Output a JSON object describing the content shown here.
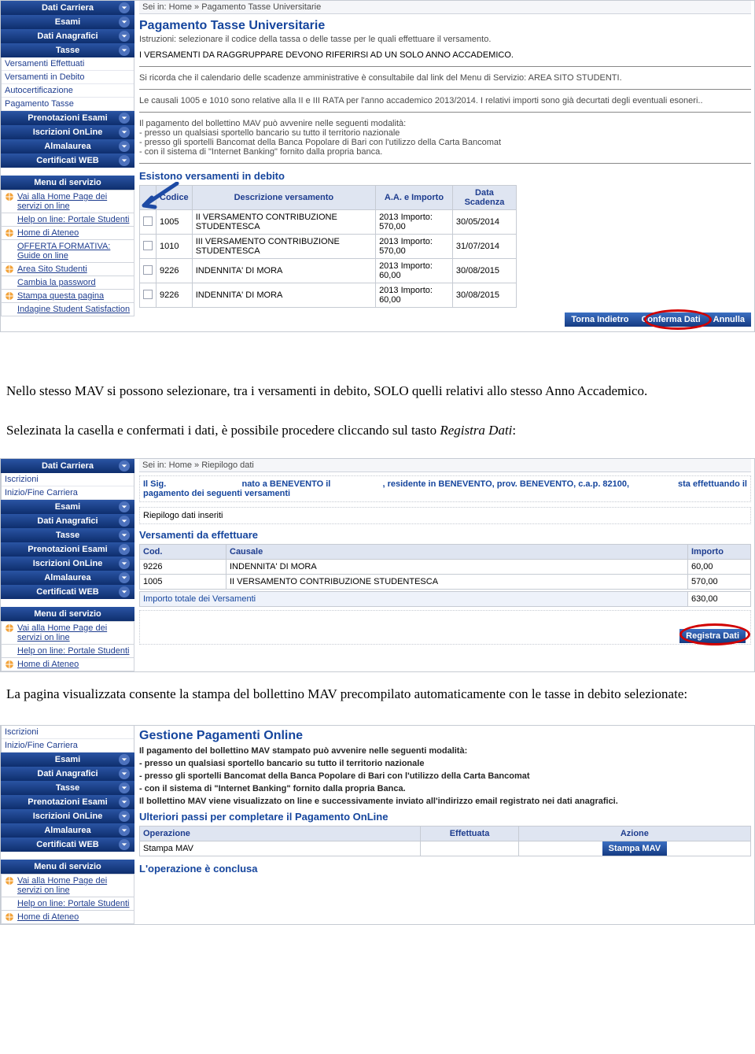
{
  "screenshot1": {
    "breadcrumb": "Sei in: Home » Pagamento Tasse Universitarie",
    "sidebar": {
      "groups": [
        {
          "label": "Dati Carriera",
          "sub": []
        },
        {
          "label": "Esami",
          "sub": []
        },
        {
          "label": "Dati Anagrafici",
          "sub": []
        },
        {
          "label": "Tasse",
          "open": true,
          "sub": [
            "Versamenti Effettuati",
            "Versamenti in Debito",
            "Autocertificazione",
            "Pagamento Tasse"
          ]
        },
        {
          "label": "Prenotazioni Esami"
        },
        {
          "label": "Iscrizioni OnLine"
        },
        {
          "label": "Almalaurea"
        },
        {
          "label": "Certificati WEB"
        }
      ],
      "service_title": "Menu di servizio",
      "service": [
        "Vai alla Home Page dei servizi on line",
        "Help on line: Portale Studenti",
        "Home di Ateneo",
        "OFFERTA FORMATIVA: Guide on line",
        "Area Sito Studenti",
        "Cambia la password",
        "Stampa questa pagina",
        "Indagine Student Satisfaction"
      ]
    },
    "title": "Pagamento Tasse Universitarie",
    "instr": "Istruzioni: selezionare il codice della tassa o delle tasse per le quali effettuare il versamento.",
    "line1": "I VERSAMENTI DA RAGGRUPPARE DEVONO RIFERIRSI AD UN SOLO ANNO ACCADEMICO.",
    "line2": "Si ricorda che il calendario delle scadenze amministrative è consultabile dal link del Menu di Servizio: AREA SITO STUDENTI.",
    "line3": "Le causali 1005 e 1010 sono relative alla II e III RATA per l'anno accademico 2013/2014. I relativi importi sono già decurtati degli eventuali esoneri..",
    "block4": [
      "Il pagamento del bollettino MAV può avvenire nelle seguenti modalità:",
      "- presso un qualsiasi sportello bancario su tutto il territorio nazionale",
      "- presso gli sportelli Bancomat della Banca Popolare di Bari con l'utilizzo della Carta Bancomat",
      "- con il sistema di \"Internet Banking\" fornito dalla propria banca."
    ],
    "tbl_title": "Esistono versamenti in debito",
    "tbl_headers": [
      "Codice",
      "Descrizione versamento",
      "A.A. e Importo",
      "Data Scadenza"
    ],
    "rows": [
      {
        "code": "1005",
        "desc": "II VERSAMENTO CONTRIBUZIONE STUDENTESCA",
        "aa": "2013 Importo: 570,00",
        "date": "30/05/2014"
      },
      {
        "code": "1010",
        "desc": "III VERSAMENTO CONTRIBUZIONE STUDENTESCA",
        "aa": "2013 Importo: 570,00",
        "date": "31/07/2014"
      },
      {
        "code": "9226",
        "desc": "INDENNITA' DI MORA",
        "aa": "2013 Importo: 60,00",
        "date": "30/08/2015"
      },
      {
        "code": "9226",
        "desc": "INDENNITA' DI MORA",
        "aa": "2013 Importo: 60,00",
        "date": "30/08/2015"
      }
    ],
    "buttons": {
      "back": "Torna Indietro",
      "confirm": "Conferma Dati",
      "cancel": "Annulla"
    }
  },
  "body_text": {
    "p1": "Nello stesso MAV si possono selezionare, tra i versamenti in debito, SOLO quelli relativi allo stesso Anno Accademico.",
    "p2a": "Selezinata la casella e confermati i dati, è possibile procedere cliccando sul tasto ",
    "p2b": "Registra Dati",
    "p2c": ":",
    "p3": "La pagina visualizzata consente la stampa del bollettino MAV precompilato automaticamente con le tasse in debito selezionate:"
  },
  "screenshot2": {
    "breadcrumb": "Sei in: Home » Riepilogo dati",
    "sidebar": {
      "groups": [
        {
          "label": "Dati Carriera",
          "open": true,
          "sub": [
            "Iscrizioni",
            "Inizio/Fine Carriera"
          ]
        },
        {
          "label": "Esami"
        },
        {
          "label": "Dati Anagrafici"
        },
        {
          "label": "Tasse"
        },
        {
          "label": "Prenotazioni Esami"
        },
        {
          "label": "Iscrizioni OnLine"
        },
        {
          "label": "Almalaurea"
        },
        {
          "label": "Certificati WEB"
        }
      ],
      "service_title": "Menu di servizio",
      "service": [
        "Vai alla Home Page dei servizi on line",
        "Help on line: Portale Studenti",
        "Home di Ateneo"
      ]
    },
    "topbox": {
      "a": "Il Sig.",
      "b": "nato a BENEVENTO il",
      "c": ", residente in BENEVENTO, prov. BENEVENTO, c.a.p. 82100,",
      "d": "sta effettuando il",
      "e": "pagamento dei seguenti versamenti"
    },
    "riep": "Riepilogo dati inseriti",
    "vtitle": "Versamenti da effettuare",
    "vheaders": [
      "Cod.",
      "Causale",
      "Importo"
    ],
    "vrows": [
      {
        "c": "9226",
        "d": "INDENNITA' DI MORA",
        "i": "60,00"
      },
      {
        "c": "1005",
        "d": "II VERSAMENTO CONTRIBUZIONE STUDENTESCA",
        "i": "570,00"
      }
    ],
    "tot_label": "Importo totale dei Versamenti",
    "tot_val": "630,00",
    "btn": "Registra Dati"
  },
  "screenshot3": {
    "sidebar": {
      "pre_sub": [
        "Iscrizioni",
        "Inizio/Fine Carriera"
      ],
      "groups": [
        {
          "label": "Esami"
        },
        {
          "label": "Dati Anagrafici"
        },
        {
          "label": "Tasse"
        },
        {
          "label": "Prenotazioni Esami"
        },
        {
          "label": "Iscrizioni OnLine"
        },
        {
          "label": "Almalaurea"
        },
        {
          "label": "Certificati WEB"
        }
      ],
      "service_title": "Menu di servizio",
      "service": [
        "Vai alla Home Page dei servizi on line",
        "Help on line: Portale Studenti",
        "Home di Ateneo"
      ]
    },
    "title": "Gestione Pagamenti Online",
    "lines": [
      "Il pagamento del bollettino MAV stampato può avvenire nelle seguenti modalità:",
      "- presso un qualsiasi sportello bancario su tutto il territorio nazionale",
      "- presso gli sportelli Bancomat della Banca Popolare di Bari con l'utilizzo della Carta Bancomat",
      "- con il sistema di \"Internet Banking\" fornito dalla propria Banca.",
      "Il bollettino MAV viene visualizzato on line e successivamente inviato all'indirizzo email registrato nei dati anagrafici."
    ],
    "sub": "Ulteriori passi per completare il Pagamento OnLine",
    "op_headers": [
      "Operazione",
      "Effettuata",
      "Azione"
    ],
    "op_row": {
      "op": "Stampa MAV",
      "eff": "",
      "btn": "Stampa MAV"
    },
    "done": "L'operazione è conclusa"
  }
}
